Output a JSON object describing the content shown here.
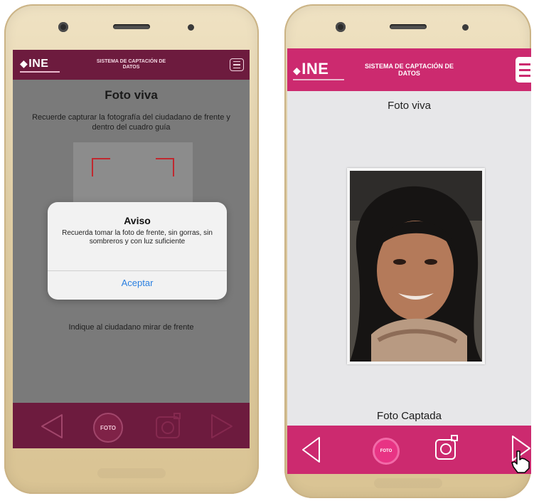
{
  "left_phone": {
    "header": {
      "logo": "INE",
      "system_title": "SISTEMA DE CAPTACIÓN DE DATOS",
      "menu_icon": "hamburger-icon"
    },
    "title": "Foto viva",
    "instructions": "Recuerde capturar la fotografía del ciudadano de frente y dentro del cuadro guía",
    "dialog": {
      "title": "Aviso",
      "message": "Recuerda tomar la foto de frente, sin gorras, sin sombreros y con luz suficiente",
      "button": "Aceptar"
    },
    "hint": "Indique al ciudadano mirar de frente",
    "toolbar": {
      "back_icon": "back-arrow-icon",
      "photo_button": "FOTO",
      "camera_icon": "camera-icon",
      "next_icon": "next-arrow-icon"
    }
  },
  "right_phone": {
    "header": {
      "logo": "INE",
      "system_title": "SISTEMA DE CAPTACIÓN DE DATOS",
      "menu_icon": "hamburger-icon"
    },
    "title": "Foto viva",
    "caption": "Foto Captada",
    "toolbar": {
      "back_icon": "back-arrow-icon",
      "photo_button": "FOTO",
      "camera_icon": "camera-icon",
      "next_icon": "next-arrow-icon",
      "cursor_icon": "hand-pointer-icon"
    }
  },
  "colors": {
    "ine_dark": "#6d1b3e",
    "ine_pink": "#cc2a6f",
    "ios_blue": "#2a7fe0",
    "guide_red": "#c0282f"
  }
}
